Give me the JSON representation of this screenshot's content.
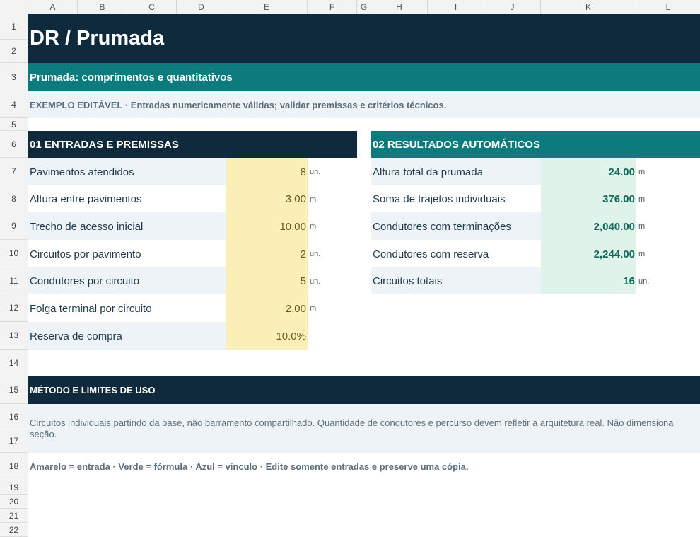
{
  "sheet": {
    "columns": [
      "A",
      "B",
      "C",
      "D",
      "E",
      "F",
      "G",
      "H",
      "I",
      "J",
      "K",
      "L"
    ],
    "rows": [
      "1",
      "2",
      "3",
      "4",
      "5",
      "6",
      "7",
      "8",
      "9",
      "10",
      "11",
      "12",
      "13",
      "14",
      "15",
      "16",
      "17",
      "18",
      "19",
      "20",
      "21",
      "22"
    ]
  },
  "header": {
    "title": "DR  /  Prumada",
    "subtitle": "Prumada: comprimentos e quantitativos",
    "example_note": "EXEMPLO EDITÁVEL · Entradas numericamente válidas; validar premissas e critérios técnicos."
  },
  "inputs": {
    "heading": "01  ENTRADAS E PREMISSAS",
    "items": [
      {
        "label": "Pavimentos atendidos",
        "value": "8",
        "unit": "un."
      },
      {
        "label": "Altura entre pavimentos",
        "value": "3.00",
        "unit": "m"
      },
      {
        "label": "Trecho de acesso inicial",
        "value": "10.00",
        "unit": "m"
      },
      {
        "label": "Circuitos por pavimento",
        "value": "2",
        "unit": "un."
      },
      {
        "label": "Condutores por circuito",
        "value": "5",
        "unit": "un."
      },
      {
        "label": "Folga terminal por circuito",
        "value": "2.00",
        "unit": "m"
      },
      {
        "label": "Reserva de compra",
        "value": "10.0%",
        "unit": ""
      }
    ]
  },
  "results": {
    "heading": "02  RESULTADOS AUTOMÁTICOS",
    "items": [
      {
        "label": "Altura total da prumada",
        "value": "24.00",
        "unit": "m"
      },
      {
        "label": "Soma de trajetos individuais",
        "value": "376.00",
        "unit": "m"
      },
      {
        "label": "Condutores com terminações",
        "value": "2,040.00",
        "unit": "m"
      },
      {
        "label": "Condutores com reserva",
        "value": "2,244.00",
        "unit": "m"
      },
      {
        "label": "Circuitos totais",
        "value": "16",
        "unit": "un."
      }
    ]
  },
  "method": {
    "heading": "MÉTODO E LIMITES DE USO",
    "text": "Circuitos individuais partindo da base, não barramento compartilhado. Quantidade de condutores e percurso devem refletir a arquitetura real. Não dimensiona seção.",
    "legend": "Amarelo = entrada · Verde = fórmula · Azul = vínculo · Edite somente entradas e preserve uma cópia."
  },
  "colors": {
    "navy": "#102a3d",
    "teal": "#0c7b7d",
    "input_fill": "#fbefb7",
    "result_fill": "#e0f3ea",
    "band_light": "#eef3f8"
  }
}
